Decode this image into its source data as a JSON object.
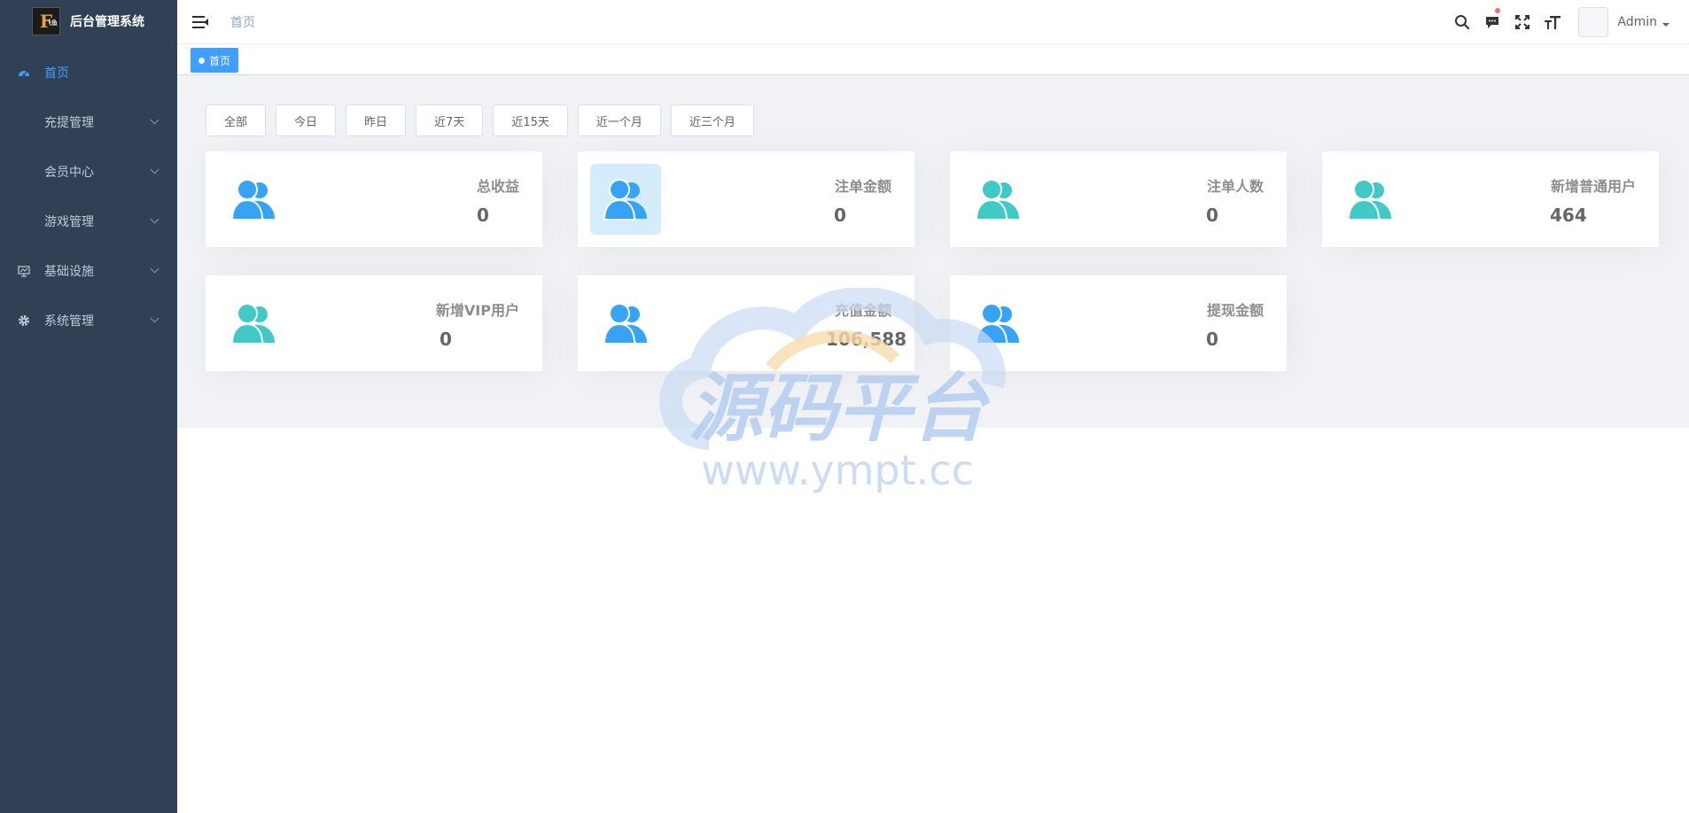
{
  "app": {
    "logo_letter": "F",
    "logo_sub": "飞鱼",
    "title": "后台管理系统"
  },
  "sidebar": {
    "items": [
      {
        "label": "首页",
        "icon": "dashboard-icon",
        "active": true,
        "has_children": false
      },
      {
        "label": "充提管理",
        "icon": "",
        "active": false,
        "has_children": true
      },
      {
        "label": "会员中心",
        "icon": "",
        "active": false,
        "has_children": true
      },
      {
        "label": "游戏管理",
        "icon": "",
        "active": false,
        "has_children": true
      },
      {
        "label": "基础设施",
        "icon": "monitor-icon",
        "active": false,
        "has_children": true
      },
      {
        "label": "系统管理",
        "icon": "gear-icon",
        "active": false,
        "has_children": true
      }
    ]
  },
  "header": {
    "breadcrumb": "首页",
    "icons": [
      "search-icon",
      "message-icon",
      "fullscreen-icon",
      "font-size-icon"
    ],
    "user": "Admin"
  },
  "tags": {
    "active": "首页"
  },
  "filters": [
    "全部",
    "今日",
    "昨日",
    "近7天",
    "近15天",
    "近一个月",
    "近三个月"
  ],
  "cards": [
    {
      "title": "总收益",
      "value": "0",
      "icon_color": "#36a3f7"
    },
    {
      "title": "注单金额",
      "value": "0",
      "icon_color": "#36a3f7"
    },
    {
      "title": "注单人数",
      "value": "0",
      "icon_color": "#40c9c6"
    },
    {
      "title": "新增普通用户",
      "value": "464",
      "icon_color": "#40c9c6"
    },
    {
      "title": "新增VIP用户",
      "value": "0",
      "icon_color": "#40c9c6"
    },
    {
      "title": "充值金额",
      "value": "106,588",
      "icon_color": "#36a3f7"
    },
    {
      "title": "提现金额",
      "value": "0",
      "icon_color": "#36a3f7"
    }
  ],
  "watermark": {
    "title": "源码平台",
    "url": "www.ympt.cc"
  },
  "colors": {
    "sidebar_bg": "#304156",
    "accent": "#409eff",
    "blue_icon": "#36a3f7",
    "teal_icon": "#40c9c6"
  }
}
